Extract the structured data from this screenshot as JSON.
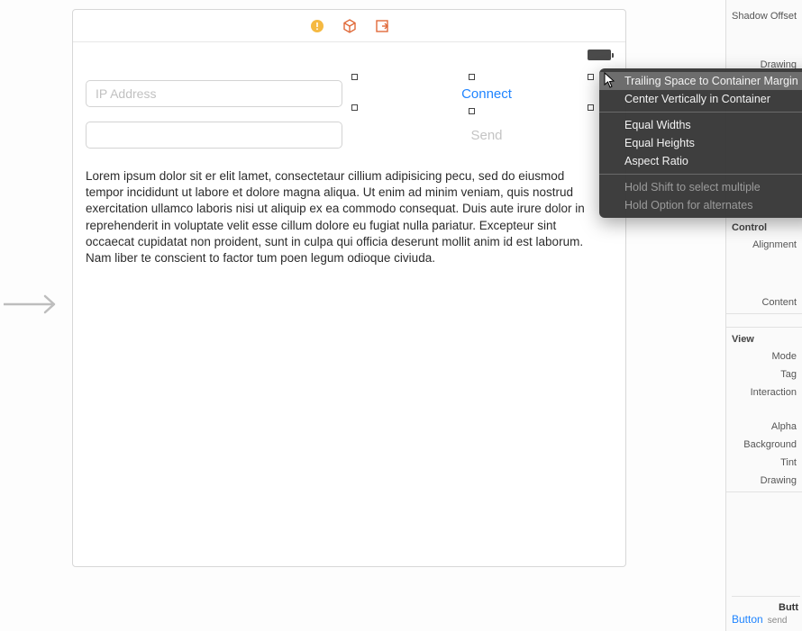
{
  "canvas": {
    "toolbar_icons": [
      "warning-icon",
      "cube-icon",
      "exit-icon"
    ],
    "battery_icon": "battery-icon",
    "ip_field": {
      "placeholder": "IP Address",
      "value": ""
    },
    "message_field": {
      "placeholder": "",
      "value": ""
    },
    "connect_button": "Connect",
    "send_button": "Send",
    "lorem_text": "Lorem ipsum dolor sit er elit lamet, consectetaur cillium adipisicing pecu, sed do eiusmod tempor incididunt ut labore et dolore magna aliqua. Ut enim ad minim veniam, quis nostrud exercitation ullamco laboris nisi ut aliquip ex ea commodo consequat. Duis aute irure dolor in reprehenderit in voluptate velit esse cillum dolore eu fugiat nulla pariatur. Excepteur sint occaecat cupidatat non proident, sunt in culpa qui officia deserunt mollit anim id est laborum. Nam liber te conscient to factor tum poen legum odioque civiuda."
  },
  "context_menu": {
    "items": [
      {
        "label": "Trailing Space to Container Margin",
        "highlight": true
      },
      {
        "label": "Center Vertically in Container",
        "highlight": false
      }
    ],
    "group2": [
      {
        "label": "Equal Widths"
      },
      {
        "label": "Equal Heights"
      },
      {
        "label": "Aspect Ratio"
      }
    ],
    "hints": [
      "Hold Shift to select multiple",
      "Hold Option for alternates"
    ]
  },
  "inspector": {
    "top_rows": [
      "Shadow Offset"
    ],
    "row_drawing": "Drawing",
    "control_header": "Control",
    "control_rows": [
      "Alignment",
      "Content"
    ],
    "view_header": "View",
    "view_rows": [
      "Mode",
      "Tag",
      "Interaction",
      "Alpha",
      "Background",
      "Tint",
      "Drawing"
    ],
    "object": {
      "title": "Butt",
      "name": "Button",
      "sub": "send"
    }
  }
}
